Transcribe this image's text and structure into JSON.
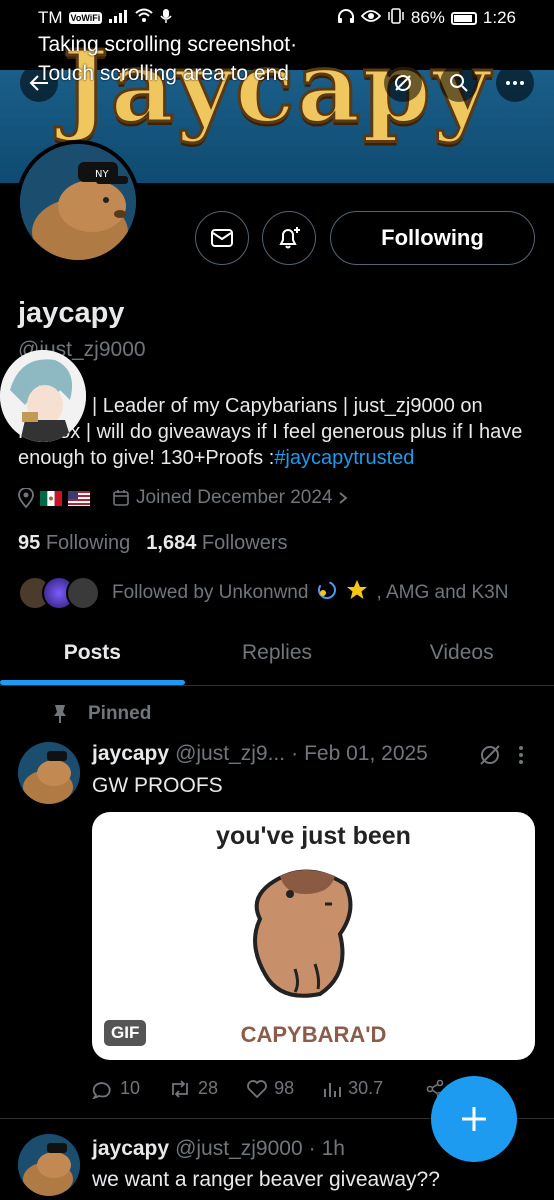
{
  "status_bar": {
    "carrier": "TM",
    "vowifi": "VoWiFi",
    "battery": "86%",
    "time": "1:26"
  },
  "scroll_hint": {
    "line1": "Taking scrolling screenshot·",
    "line2": "Touch scrolling area to end"
  },
  "banner": {
    "text": "Jaycapy"
  },
  "profile": {
    "name": "jaycapy",
    "handle": "@just_zj9000",
    "bio_text": "| Leader of my Capybarians | just_zj9000 on Roblox | will do giveaways if I feel generous plus if I have enough to give! 130+Proofs :",
    "bio_tag": "#jaycapytrusted",
    "joined": "Joined December 2024",
    "following_count": "95",
    "following_label": "Following",
    "followers_count": "1,684",
    "followers_label": "Followers",
    "followed_by": "Followed by Unkonwnd",
    "followed_by_rest": ", AMG and K3N"
  },
  "buttons": {
    "follow": "Following"
  },
  "tabs": [
    {
      "label": "Posts"
    },
    {
      "label": "Replies"
    },
    {
      "label": "Videos"
    }
  ],
  "posts": [
    {
      "pinned_label": "Pinned",
      "name": "jaycapy",
      "handle": "@just_zj9...",
      "date": "Feb 01, 2025",
      "text": "GW PROOFS",
      "media_top": "you've just been",
      "media_bottom": "CAPYBARA'D",
      "media_badge": "GIF",
      "replies": "10",
      "reposts": "28",
      "likes": "98",
      "views": "30.7"
    },
    {
      "name": "jaycapy",
      "handle": "@just_zj9000",
      "date": "1h",
      "text": "we want a ranger beaver giveaway??"
    }
  ],
  "colors": {
    "accent": "#1d9bf0",
    "muted": "#71767b",
    "text": "#e7e9ea",
    "background": "#000000"
  }
}
